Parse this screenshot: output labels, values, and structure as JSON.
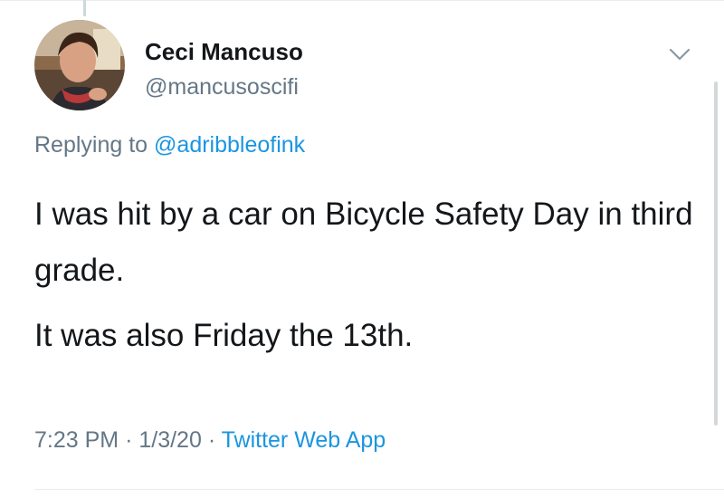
{
  "tweet": {
    "author": {
      "display_name": "Ceci Mancuso",
      "handle": "@mancusoscifi"
    },
    "reply": {
      "prefix": "Replying to",
      "mention": "@adribbleofink"
    },
    "paragraphs": [
      "I was hit by a car on Bicycle Safety Day in third grade.",
      "It was also Friday the 13th."
    ],
    "meta": {
      "time": "7:23 PM",
      "separator": "·",
      "date": "1/3/20",
      "source": "Twitter Web App"
    }
  },
  "icons": {
    "menu": "chevron-down-icon"
  },
  "colors": {
    "link": "#1b95e0",
    "secondary_text": "#657786",
    "primary_text": "#14171a"
  }
}
